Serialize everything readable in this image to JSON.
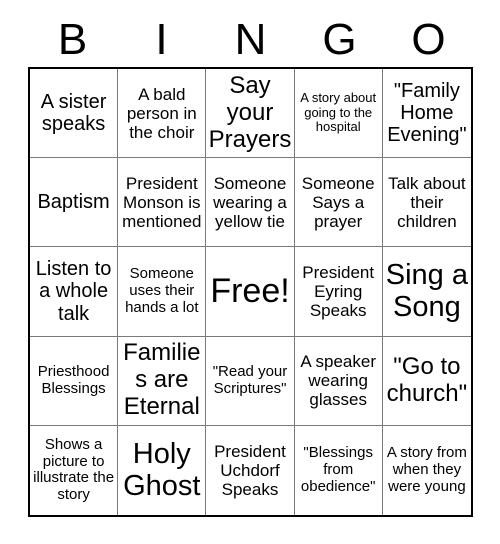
{
  "header": {
    "letters": [
      "B",
      "I",
      "N",
      "G",
      "O"
    ]
  },
  "colors": {
    "outer_border": "#000000",
    "inner_border": "#7a7a7a",
    "background": "#ffffff",
    "text": "#000000"
  },
  "grid": {
    "rows": 5,
    "columns": 5,
    "cells": [
      {
        "text": "A sister speaks",
        "size": "l",
        "free": false
      },
      {
        "text": "A bald person in the choir",
        "size": "m",
        "free": false
      },
      {
        "text": "Say your Prayers",
        "size": "xl",
        "free": false
      },
      {
        "text": "A story about going to the hospital",
        "size": "xs",
        "free": false
      },
      {
        "text": "\"Family Home Evening\"",
        "size": "l",
        "free": false
      },
      {
        "text": "Baptism",
        "size": "l",
        "free": false
      },
      {
        "text": "President Monson is mentioned",
        "size": "m",
        "free": false
      },
      {
        "text": "Someone wearing a yellow tie",
        "size": "m",
        "free": false
      },
      {
        "text": "Someone Says a prayer",
        "size": "m",
        "free": false
      },
      {
        "text": "Talk about their children",
        "size": "m",
        "free": false
      },
      {
        "text": "Listen to a whole talk",
        "size": "l",
        "free": false
      },
      {
        "text": "Someone uses their hands a lot",
        "size": "s",
        "free": false
      },
      {
        "text": "Free!",
        "size": "free",
        "free": true
      },
      {
        "text": "President Eyring Speaks",
        "size": "m",
        "free": false
      },
      {
        "text": "Sing a Song",
        "size": "xxl",
        "free": false
      },
      {
        "text": "Priesthood Blessings",
        "size": "s",
        "free": false
      },
      {
        "text": "Families are Eternal",
        "size": "xl",
        "free": false
      },
      {
        "text": "\"Read your Scriptures\"",
        "size": "s",
        "free": false
      },
      {
        "text": "A speaker wearing glasses",
        "size": "m",
        "free": false
      },
      {
        "text": "\"Go to church\"",
        "size": "xl",
        "free": false
      },
      {
        "text": "Shows a picture to illustrate the story",
        "size": "s",
        "free": false
      },
      {
        "text": "Holy Ghost",
        "size": "xxl",
        "free": false
      },
      {
        "text": "President Uchdorf Speaks",
        "size": "m",
        "free": false
      },
      {
        "text": "\"Blessings from obedience\"",
        "size": "s",
        "free": false
      },
      {
        "text": "A story from when they were young",
        "size": "s",
        "free": false
      }
    ]
  }
}
